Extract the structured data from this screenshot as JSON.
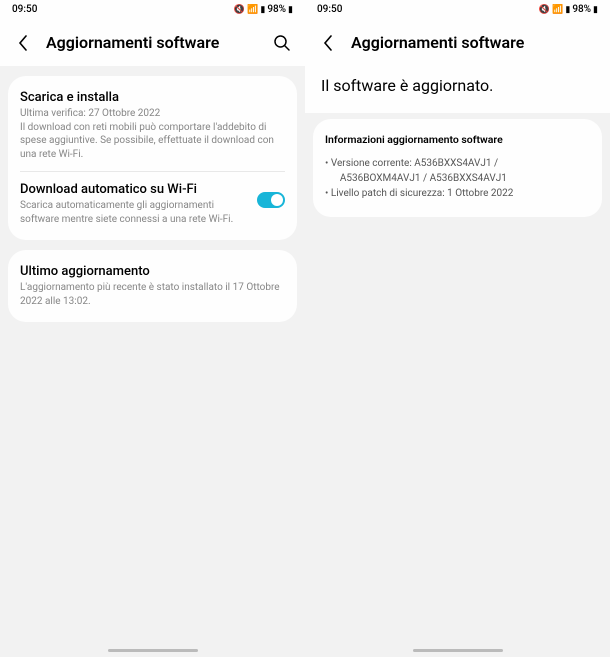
{
  "status": {
    "time": "09:50",
    "battery": "98%"
  },
  "screen1": {
    "title": "Aggiornamenti software",
    "download": {
      "title": "Scarica e installa",
      "lastCheck": "Ultima verifica: 27 Ottobre 2022",
      "desc": "Il download con reti mobili può comportare l'addebito di spese aggiuntive. Se possibile, effettuate il download con una rete Wi-Fi."
    },
    "autoDownload": {
      "title": "Download automatico su Wi-Fi",
      "desc": "Scarica automaticamente gli aggiornamenti software mentre siete connessi a una rete Wi-Fi."
    },
    "lastUpdate": {
      "title": "Ultimo aggiornamento",
      "desc": "L'aggiornamento più recente è stato installato il 17 Ottobre 2022 alle 13:02."
    }
  },
  "screen2": {
    "title": "Aggiornamenti software",
    "message": "Il software è aggiornato.",
    "info": {
      "heading": "Informazioni aggiornamento software",
      "line1": "• Versione corrente: A536BXXS4AVJ1 /",
      "line2": "      A536BOXM4AVJ1 / A536BXXS4AVJ1",
      "line3": "• Livello patch di sicurezza: 1 Ottobre 2022"
    }
  }
}
